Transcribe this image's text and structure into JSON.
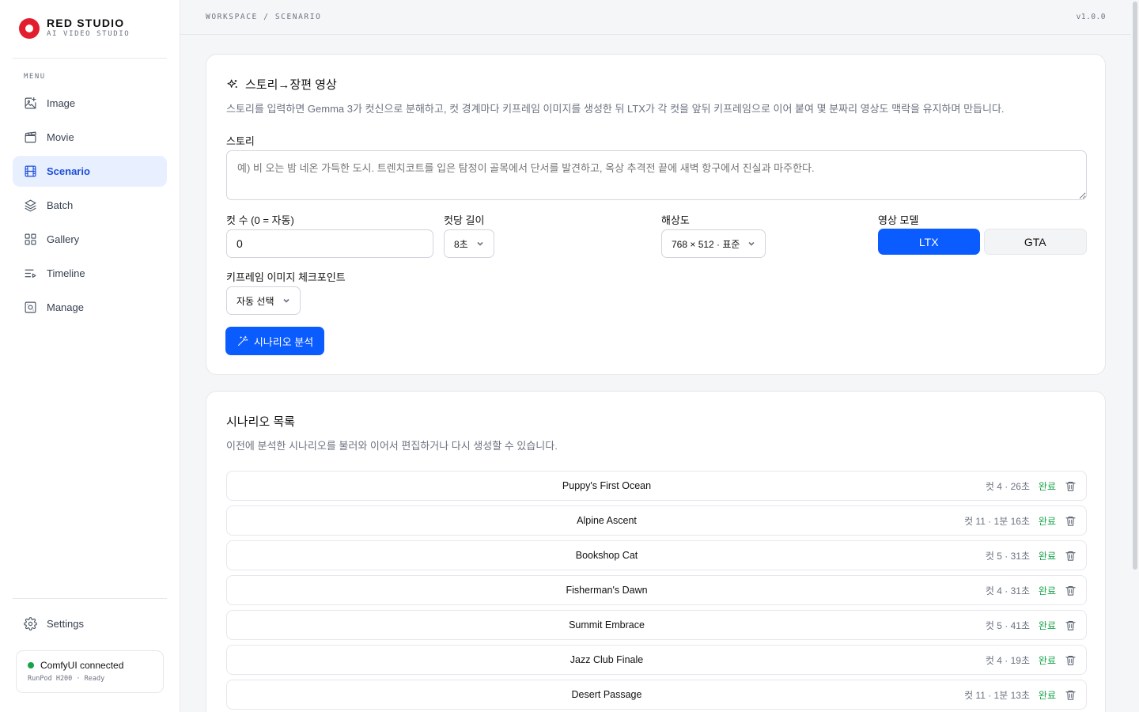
{
  "brand": {
    "name": "RED STUDIO",
    "subtitle": "AI VIDEO STUDIO",
    "color": "#e11d2e"
  },
  "sidebar": {
    "menu_label": "MENU",
    "items": [
      {
        "label": "Image",
        "icon": "image-plus-icon",
        "active": false
      },
      {
        "label": "Movie",
        "icon": "clapperboard-icon",
        "active": false
      },
      {
        "label": "Scenario",
        "icon": "film-icon",
        "active": true
      },
      {
        "label": "Batch",
        "icon": "layers-icon",
        "active": false
      },
      {
        "label": "Gallery",
        "icon": "grid-icon",
        "active": false
      },
      {
        "label": "Timeline",
        "icon": "list-play-icon",
        "active": false
      },
      {
        "label": "Manage",
        "icon": "manage-icon",
        "active": false
      }
    ],
    "settings_label": "Settings",
    "status": {
      "title": "ComfyUI connected",
      "detail": "RunPod H200 · Ready",
      "color": "#16a34a"
    }
  },
  "topbar": {
    "breadcrumb": "WORKSPACE / SCENARIO",
    "version": "v1.0.0"
  },
  "story_card": {
    "title": "스토리→장편 영상",
    "description": "스토리를 입력하면 Gemma 3가 컷신으로 분해하고, 컷 경계마다 키프레임 이미지를 생성한 뒤 LTX가 각 컷을 앞뒤 키프레임으로 이어 붙여 몇 분짜리 영상도 맥락을 유지하며 만듭니다.",
    "story_label": "스토리",
    "story_placeholder": "예) 비 오는 밤 네온 가득한 도시. 트렌치코트를 입은 탐정이 골목에서 단서를 발견하고, 옥상 추격전 끝에 새벽 항구에서 진실과 마주한다.",
    "story_value": "",
    "cuts_label": "컷 수 (0 = 자동)",
    "cuts_value": "0",
    "cut_length_label": "컷당 길이",
    "cut_length_value": "8초",
    "resolution_label": "해상도",
    "resolution_value": "768 × 512 · 표준",
    "model_label": "영상 모델",
    "models": [
      {
        "label": "LTX",
        "selected": true
      },
      {
        "label": "GTA",
        "selected": false
      }
    ],
    "checkpoint_label": "키프레임 이미지 체크포인트",
    "checkpoint_value": "자동 선택",
    "analyze_button": "시나리오 분석",
    "accent": "#0a5cff"
  },
  "list_card": {
    "title": "시나리오 목록",
    "description": "이전에 분석한 시나리오를 불러와 이어서 편집하거나 다시 생성할 수 있습니다.",
    "rows": [
      {
        "title": "Puppy's First Ocean",
        "meta": "컷 4 · 26초",
        "status": "완료"
      },
      {
        "title": "Alpine Ascent",
        "meta": "컷 11 · 1분 16초",
        "status": "완료"
      },
      {
        "title": "Bookshop Cat",
        "meta": "컷 5 · 31초",
        "status": "완료"
      },
      {
        "title": "Fisherman's Dawn",
        "meta": "컷 4 · 31초",
        "status": "완료"
      },
      {
        "title": "Summit Embrace",
        "meta": "컷 5 · 41초",
        "status": "완료"
      },
      {
        "title": "Jazz Club Finale",
        "meta": "컷 4 · 19초",
        "status": "완료"
      },
      {
        "title": "Desert Passage",
        "meta": "컷 11 · 1분 13초",
        "status": "완료"
      }
    ]
  }
}
